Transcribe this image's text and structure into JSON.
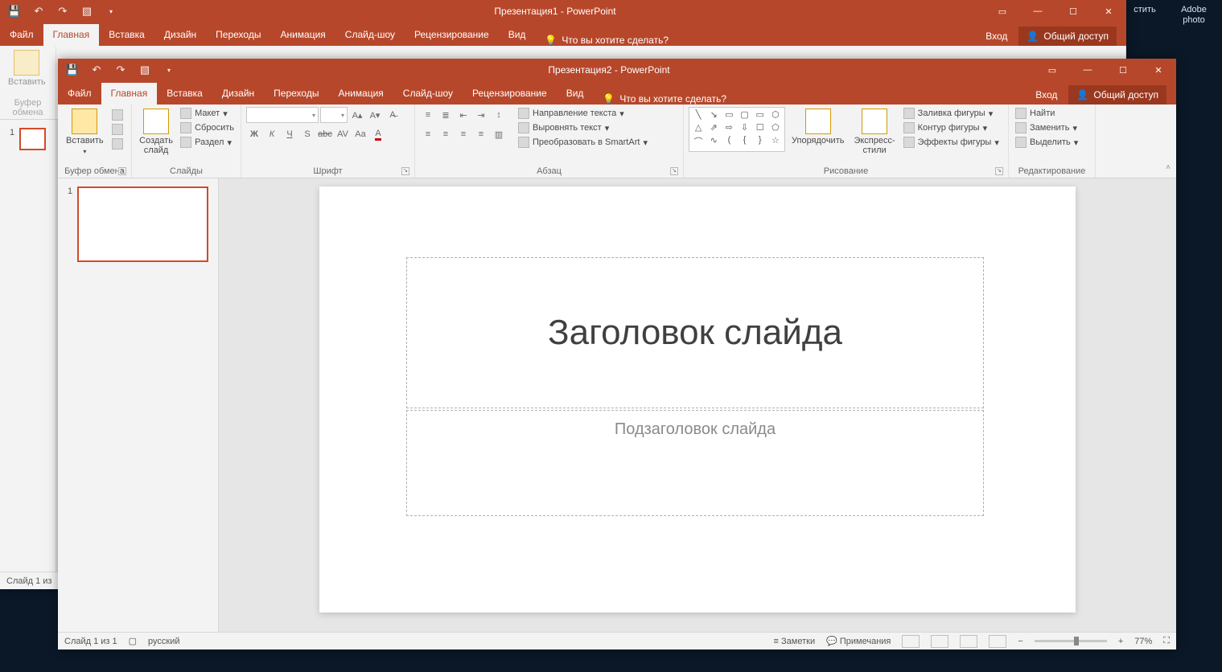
{
  "desktop": {
    "icon1": "стить",
    "icon2": "Adobe photo"
  },
  "back": {
    "title": "Презентация1 - PowerPoint",
    "tabs": [
      "Файл",
      "Главная",
      "Вставка",
      "Дизайн",
      "Переходы",
      "Анимация",
      "Слайд-шоу",
      "Рецензирование",
      "Вид"
    ],
    "activeTab": 1,
    "tellme": "Что вы хотите сделать?",
    "signin": "Вход",
    "share": "Общий доступ",
    "clip_label": "Буфер обмена",
    "status_slide": "Слайд 1 из"
  },
  "front": {
    "title": "Презентация2 - PowerPoint",
    "tabs": [
      "Файл",
      "Главная",
      "Вставка",
      "Дизайн",
      "Переходы",
      "Анимация",
      "Слайд-шоу",
      "Рецензирование",
      "Вид"
    ],
    "activeTab": 1,
    "tellme": "Что вы хотите сделать?",
    "signin": "Вход",
    "share": "Общий доступ",
    "ribbon": {
      "clipboard": {
        "paste": "Вставить",
        "label": "Буфер обмена"
      },
      "slides": {
        "new": "Создать\nслайд",
        "layout": "Макет",
        "reset": "Сбросить",
        "section": "Раздел",
        "label": "Слайды"
      },
      "font": {
        "label": "Шрифт",
        "bold": "Ж",
        "italic": "К",
        "underline": "Ч",
        "shadow": "S",
        "strike": "abc",
        "charsp": "AV",
        "case": "Aa",
        "color": "A"
      },
      "para": {
        "label": "Абзац",
        "textdir": "Направление текста",
        "align": "Выровнять текст",
        "smart": "Преобразовать в SmartArt"
      },
      "draw": {
        "label": "Рисование",
        "arrange": "Упорядочить",
        "quick": "Экспресс-\nстили",
        "fill": "Заливка фигуры",
        "outline": "Контур фигуры",
        "effects": "Эффекты фигуры"
      },
      "edit": {
        "label": "Редактирование",
        "find": "Найти",
        "replace": "Заменить",
        "select": "Выделить"
      }
    },
    "thumb_num": "1",
    "slide": {
      "title": "Заголовок слайда",
      "subtitle": "Подзаголовок слайда"
    },
    "status": {
      "slide": "Слайд 1 из 1",
      "lang": "русский",
      "notes": "Заметки",
      "comments": "Примечания",
      "zoom": "77%"
    }
  }
}
